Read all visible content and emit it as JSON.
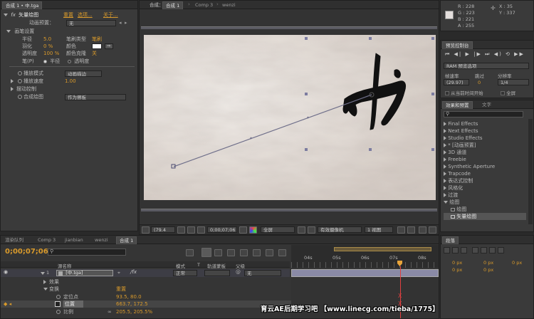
{
  "effect_controls": {
    "tab_label": "合成 1 • 中.tga",
    "effect_name": "矢量绘图",
    "effect_actions": [
      "重置",
      "选项...",
      "关于..."
    ],
    "anim_preset_label": "动画预置：",
    "anim_preset_value": "无",
    "brush_group": "画笔设置",
    "radius_label": "半径",
    "radius_value": "5.0",
    "brush_type_label": "笔刷类型",
    "brush_type_value": "笔刷",
    "feather_label": "羽化",
    "feather_value": "0 %",
    "color_label": "颜色",
    "opacity_label": "透明度",
    "opacity_value": "100 %",
    "color_jitter_label": "颜色克隆",
    "color_jitter_value": "关",
    "pen_label": "笔(P)",
    "pen_opt_radius": "半径",
    "pen_opt_opacity": "透明度",
    "playback_mode_label": "播放模式",
    "playback_mode_value": "动画描边",
    "playback_speed_label": "播放速度",
    "playback_speed_value": "1.00",
    "shake_label": "摆动控制",
    "composite_label": "合成绘图",
    "composite_value": "作为擦板",
    "brush_color": "#ffffff"
  },
  "composition": {
    "tabs": [
      "合成：",
      "合成 1",
      "Comp 3",
      "wenzi"
    ],
    "footer": {
      "zoom": "(79.4",
      "timecode": "0;00;07;06",
      "resolution": "全屏",
      "camera": "有效摄像机",
      "views": "1 视图"
    }
  },
  "info": {
    "r": "R : 228",
    "g": "G : 223",
    "b": "B : 221",
    "a": "A : 255",
    "x": "X : 35",
    "y": "Y : 337",
    "swatch": "#e4dfdd"
  },
  "preview": {
    "title": "预览控制台",
    "ram_options": "RAM 预览选项",
    "frame_rate_label": "帧速率",
    "skip_label": "跳过",
    "resolution_label": "分辨率",
    "frame_rate_value": "(29.97)",
    "skip_value": "0",
    "resolution_value": "1/4",
    "from_current": "从当前时间开始",
    "fullscreen": "全屏"
  },
  "effects_panel": {
    "tabs": [
      "效果和预置",
      "文字"
    ],
    "items": [
      "Final Effects",
      "Next Effects",
      "Studio Effects",
      "* [动画预置]",
      "3D 通道",
      "Freebie",
      "Synthetic Aperture",
      "Trapcode",
      "表达式控制",
      "风格化",
      "过渡",
      "绘图"
    ],
    "sub_items": [
      "绘图",
      "矢量绘图"
    ]
  },
  "timeline": {
    "tabs": [
      "渲染队列",
      "Comp 3",
      "jianbian",
      "wenzi",
      "合成 1"
    ],
    "timecode": "0;00;07;06",
    "col_headers": [
      "源名称",
      "模式",
      "T",
      "轨道蒙板",
      "父级"
    ],
    "ruler": [
      "04s",
      "05s",
      "06s",
      "07s",
      "08s"
    ],
    "layer": {
      "index": "1",
      "name": "[中.tga]",
      "mode": "正常",
      "parent": "无"
    },
    "effects_label": "效果",
    "transform_label": "变换",
    "transform_reset": "重置",
    "anchor_label": "定位点",
    "anchor_value": "93.5, 80.0",
    "position_label": "位置",
    "position_value": "663.7, 172.5",
    "scale_label": "比例",
    "scale_value": "205.5, 205.5%"
  },
  "paragraph": {
    "tabs": [
      "段落"
    ],
    "px_values": [
      "0 px",
      "0 px",
      "0 px",
      "0 px",
      "0 px"
    ]
  },
  "watermark": "育云AE后期学习吧 【www.linecg.com/tieba/1775】"
}
